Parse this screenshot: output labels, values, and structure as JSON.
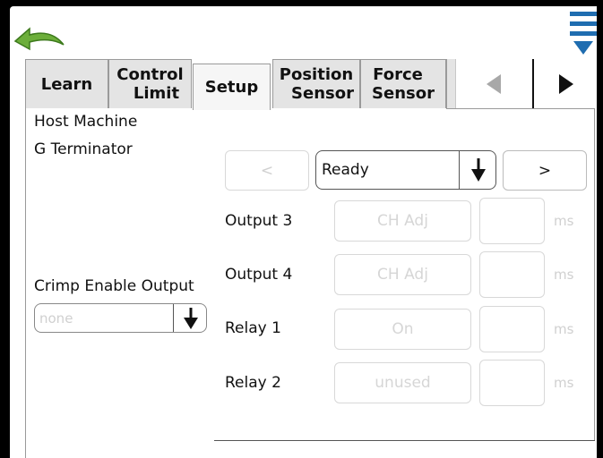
{
  "colors": {
    "accent_blue": "#1f6db0",
    "back_arrow_green": "#6cae3a"
  },
  "icons": {
    "back": "back-arrow-icon",
    "menu": "menu-lines-icon",
    "prev": "left-triangle-icon",
    "next": "right-triangle-icon",
    "dropdown": "down-arrow-icon"
  },
  "tabs": [
    {
      "line1": "Learn",
      "line2": ""
    },
    {
      "line1": "Control",
      "line2": "Limit"
    },
    {
      "line1": "Setup",
      "line2": ""
    },
    {
      "line1": "Position",
      "line2": "Sensor"
    },
    {
      "line1": "Force",
      "line2": "Sensor"
    }
  ],
  "left": {
    "host_machine": "Host Machine",
    "terminator": "G Terminator",
    "crimp_enable_label": "Crimp Enable Output",
    "crimp_enable_value": "none"
  },
  "selector": {
    "prev_label": "<",
    "value": "Ready",
    "next_label": ">"
  },
  "outputs": [
    {
      "label": "Output 3",
      "value": "CH Adj",
      "unit": "ms"
    },
    {
      "label": "Output 4",
      "value": "CH Adj",
      "unit": "ms"
    },
    {
      "label": "Relay 1",
      "value": "On",
      "unit": "ms"
    },
    {
      "label": "Relay 2",
      "value": "unused",
      "unit": "ms"
    }
  ]
}
